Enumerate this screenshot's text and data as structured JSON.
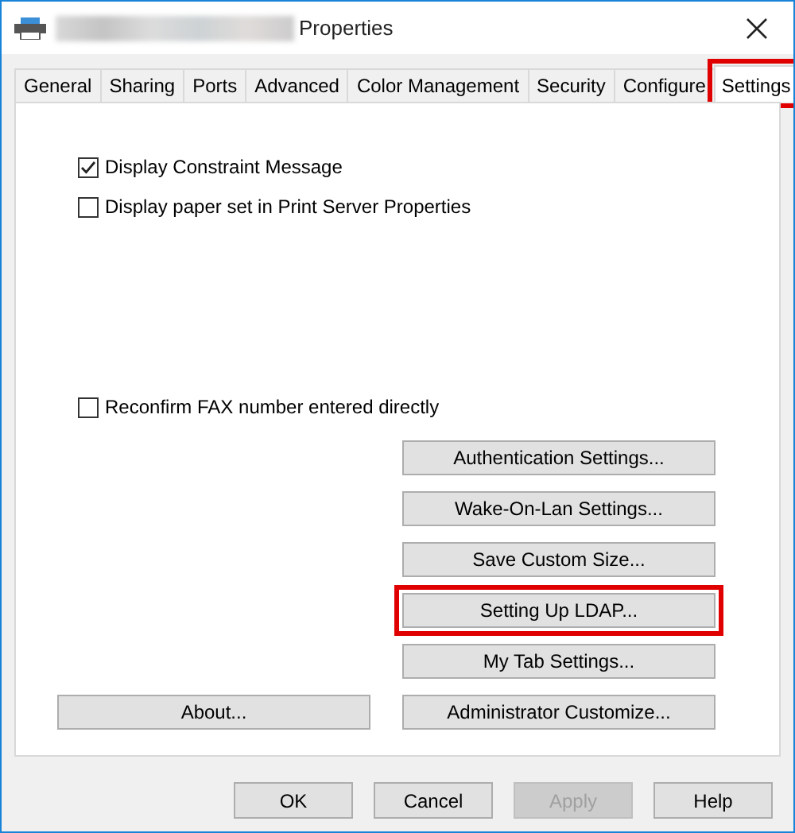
{
  "window": {
    "title": "Properties"
  },
  "tabs": [
    {
      "label": "General",
      "selected": false,
      "highlighted": false
    },
    {
      "label": "Sharing",
      "selected": false,
      "highlighted": false
    },
    {
      "label": "Ports",
      "selected": false,
      "highlighted": false
    },
    {
      "label": "Advanced",
      "selected": false,
      "highlighted": false
    },
    {
      "label": "Color Management",
      "selected": false,
      "highlighted": false
    },
    {
      "label": "Security",
      "selected": false,
      "highlighted": false
    },
    {
      "label": "Configure",
      "selected": false,
      "highlighted": false
    },
    {
      "label": "Settings",
      "selected": true,
      "highlighted": true
    }
  ],
  "checkboxes": [
    {
      "label": "Display Constraint Message",
      "checked": true
    },
    {
      "label": "Display paper set in Print Server Properties",
      "checked": false
    }
  ],
  "fax_checkbox": {
    "label": "Reconfirm FAX number entered directly",
    "checked": false
  },
  "settings_buttons": [
    {
      "label": "Authentication Settings...",
      "highlighted": false
    },
    {
      "label": "Wake-On-Lan Settings...",
      "highlighted": false
    },
    {
      "label": "Save Custom Size...",
      "highlighted": false
    },
    {
      "label": "Setting Up LDAP...",
      "highlighted": true
    },
    {
      "label": "My Tab Settings...",
      "highlighted": false
    }
  ],
  "about_button": {
    "label": "About..."
  },
  "admin_button": {
    "label": "Administrator Customize...",
    "highlighted": false
  },
  "dialog_buttons": [
    {
      "label": "OK",
      "disabled": false
    },
    {
      "label": "Cancel",
      "disabled": false
    },
    {
      "label": "Apply",
      "disabled": true
    },
    {
      "label": "Help",
      "disabled": false
    }
  ]
}
